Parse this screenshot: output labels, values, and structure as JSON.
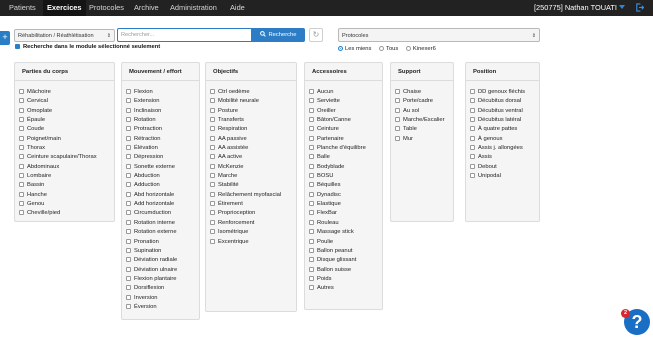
{
  "nav": {
    "items": [
      "Patients",
      "Exercices",
      "Protocoles",
      "Archive",
      "Administration",
      "Aide"
    ],
    "active": "Exercices",
    "user": "[250775] Nathan TOUATI"
  },
  "toolbar": {
    "category_select": "Réhabilitation / Réathlétisation",
    "search_placeholder": "Rechercher...",
    "search_button": "Recherche",
    "protocol_select": "Protocoles",
    "module_only_label": "Recherche dans le module sélectionné seulement",
    "module_only_checked": true,
    "radios": [
      "Les miens",
      "Tous",
      "Kinexer6"
    ],
    "radio_selected": "Les miens"
  },
  "panels": [
    {
      "title": "Parties du corps",
      "items": [
        "Mâchoire",
        "Cervical",
        "Omoplate",
        "Épaule",
        "Coude",
        "Poignet/main",
        "Thorax",
        "Ceinture scapulaire/Thorax",
        "Abdominaux",
        "Lombaire",
        "Bassin",
        "Hanche",
        "Genou",
        "Cheville/pied"
      ]
    },
    {
      "title": "Mouvement / effort",
      "items": [
        "Flexion",
        "Extension",
        "Inclinaison",
        "Rotation",
        "Protraction",
        "Rétraction",
        "Élévation",
        "Dépression",
        "Sonette externe",
        "Abduction",
        "Adduction",
        "Abd horizontale",
        "Add horizontale",
        "Circumduction",
        "Rotation interne",
        "Rotation externe",
        "Pronation",
        "Supination",
        "Déviation radiale",
        "Déviation ulnaire",
        "Flexion plantaire",
        "Dorsiflexion",
        "Inversion",
        "Éversion"
      ]
    },
    {
      "title": "Objectifs",
      "items": [
        "Ctrl oedème",
        "Mobilité neurale",
        "Posture",
        "Transferts",
        "Respiration",
        "AA passive",
        "AA assistée",
        "AA active",
        "McKenzie",
        "Marche",
        "Stabilité",
        "Relâchement myofascial",
        "Étirement",
        "Proprioception",
        "Renforcement",
        "Isométrique",
        "Excentrique"
      ]
    },
    {
      "title": "Accessoires",
      "items": [
        "Aucun",
        "Serviette",
        "Oreiller",
        "Bâton/Canne",
        "Ceinture",
        "Partenaire",
        "Planche d'équilibre",
        "Balle",
        "Bodyblade",
        "BOSU",
        "Béquilles",
        "Dynadisc",
        "Elastique",
        "FlexBar",
        "Rouleau",
        "Massage stick",
        "Poulie",
        "Ballon peanut",
        "Disque glissant",
        "Ballon suisse",
        "Poids",
        "Autres"
      ]
    },
    {
      "title": "Support",
      "items": [
        "Chaise",
        "Porte/cadre",
        "Au sol",
        "Marche/Escalier",
        "Table",
        "Mur"
      ]
    },
    {
      "title": "Position",
      "items": [
        "DD genoux fléchis",
        "Décubitus dorsal",
        "Décubitus ventral",
        "Décubitus latéral",
        "À quatre pattes",
        "À genoux",
        "Assis j. allongées",
        "Assis",
        "Debout",
        "Unipodal"
      ]
    }
  ],
  "help": {
    "badge": "2",
    "label": "?"
  }
}
